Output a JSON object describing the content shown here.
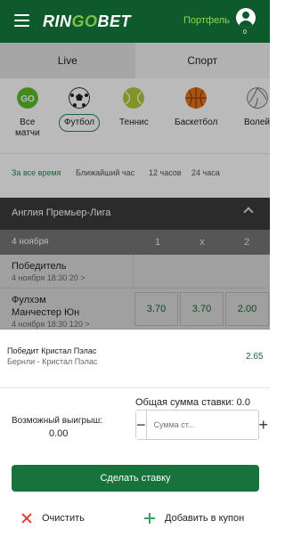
{
  "header": {
    "logo_prefix": "RIN",
    "logo_go": "GO",
    "logo_suffix": "BET",
    "portfolio": "Портфель",
    "portfolio_count": "0"
  },
  "tabs": [
    {
      "label": "Live",
      "active": false
    },
    {
      "label": "Спорт",
      "active": true
    }
  ],
  "sports": [
    {
      "label": "Все\nматчи",
      "icon": "go-icon"
    },
    {
      "label": "Футбол",
      "icon": "football-icon",
      "selected": true
    },
    {
      "label": "Теннис",
      "icon": "tennis-icon"
    },
    {
      "label": "Баскетбол",
      "icon": "basketball-icon"
    },
    {
      "label": "Волей",
      "icon": "volleyball-icon"
    }
  ],
  "periods": [
    "За все время",
    "Ближайший час",
    "12 часов",
    "24 часа"
  ],
  "league": {
    "title": "Англия Премьер-Лига"
  },
  "table": {
    "date": "4 ноября",
    "headers": [
      "1",
      "x",
      "2"
    ],
    "rows": [
      {
        "name": "Победитель",
        "time": "4 ноября 18:30 20 >",
        "odds": []
      },
      {
        "name": "Фулхэм\nМанчестер Юн",
        "time": "4 ноября 18:30 120 >",
        "odds": [
          "3.70",
          "3.70",
          "2.00"
        ]
      }
    ]
  },
  "bet": {
    "title": "Победит Кристал Пэлас",
    "match": "Бернли - Кристал Пэлас",
    "odd": "2.65"
  },
  "stake": {
    "total_label": "Общая сумма ставки: 0.0",
    "win_label": "Возможный выигрыш:",
    "win_value": "0.00",
    "minus": "−",
    "plus": "+",
    "placeholder": "Сумма ст..."
  },
  "actions": {
    "submit": "Сделать ставку",
    "clear": "Очистить",
    "add": "Добавить в купон"
  },
  "colors": {
    "brand": "#0e5a2c",
    "accent": "#17723c",
    "odds": "#0c6a33",
    "clear": "#e53935",
    "add": "#3aa35a"
  }
}
